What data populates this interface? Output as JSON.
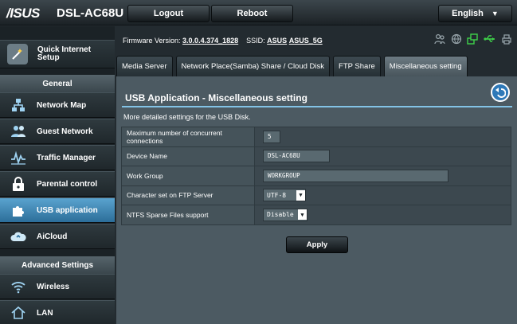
{
  "header": {
    "brand": "/ISUS",
    "model": "DSL-AC68U",
    "logout_label": "Logout",
    "reboot_label": "Reboot",
    "language": "English"
  },
  "status": {
    "firmware_label": "Firmware Version:",
    "firmware_value": "3.0.0.4.374_1828",
    "ssid_label": "SSID:",
    "ssid_values": [
      "ASUS",
      "ASUS_5G"
    ],
    "icons": [
      "user-group-icon",
      "globe-icon",
      "network-status-icon",
      "usb-icon",
      "printer-icon"
    ]
  },
  "nav": {
    "quick_setup": "Quick Internet Setup",
    "general_header": "General",
    "general_items": [
      {
        "label": "Network Map",
        "icon": "network-map-icon"
      },
      {
        "label": "Guest Network",
        "icon": "guest-network-icon"
      },
      {
        "label": "Traffic Manager",
        "icon": "traffic-manager-icon"
      },
      {
        "label": "Parental control",
        "icon": "lock-icon"
      },
      {
        "label": "USB application",
        "icon": "puzzle-icon",
        "active": true
      },
      {
        "label": "AiCloud",
        "icon": "cloud-icon"
      }
    ],
    "advanced_header": "Advanced Settings",
    "advanced_items": [
      {
        "label": "Wireless",
        "icon": "wifi-icon"
      },
      {
        "label": "LAN",
        "icon": "home-icon"
      }
    ]
  },
  "tabs": [
    {
      "label": "Media Server"
    },
    {
      "label": "Network Place(Samba) Share / Cloud Disk"
    },
    {
      "label": "FTP Share"
    },
    {
      "label": "Miscellaneous setting",
      "active": true
    }
  ],
  "page": {
    "title": "USB Application - Miscellaneous setting",
    "description": "More detailed settings for the USB Disk.",
    "rows": [
      {
        "label": "Maximum number of concurrent connections",
        "value": "5",
        "kind": "input"
      },
      {
        "label": "Device Name",
        "value": "DSL-AC68U",
        "kind": "input"
      },
      {
        "label": "Work Group",
        "value": "WORKGROUP",
        "kind": "input"
      },
      {
        "label": "Character set on FTP Server",
        "value": "UTF-8",
        "kind": "select"
      },
      {
        "label": "NTFS Sparse Files support",
        "value": "Disable",
        "kind": "select"
      }
    ],
    "apply_label": "Apply"
  },
  "colors": {
    "accent": "#5aa3cf",
    "panel": "#4c5a62",
    "rule": "#83c3e6"
  }
}
